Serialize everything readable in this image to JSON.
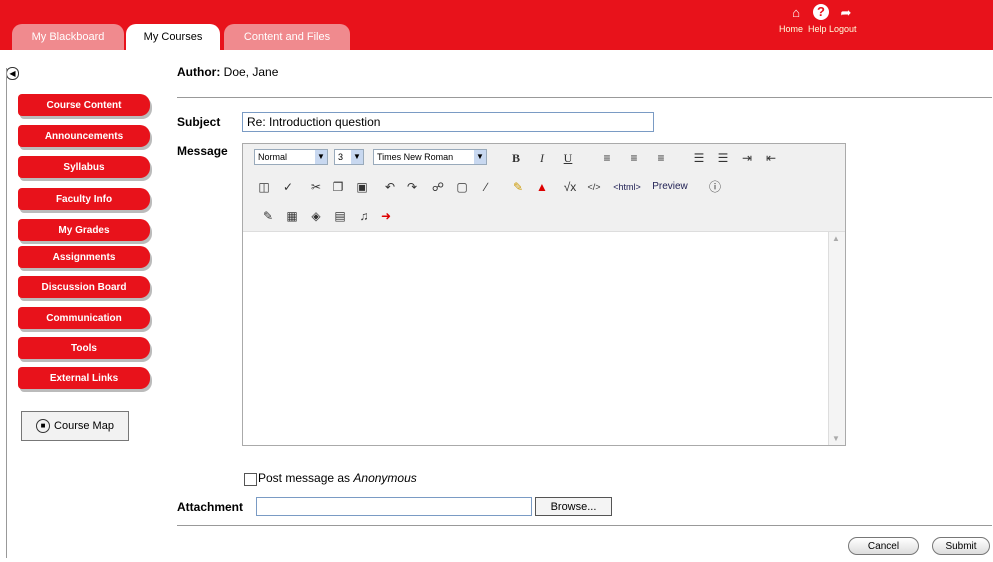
{
  "tabs": [
    {
      "label": "My Blackboard",
      "active": false
    },
    {
      "label": "My Courses",
      "active": true
    },
    {
      "label": "Content and Files",
      "active": false
    }
  ],
  "topnav": {
    "home": "Home",
    "help": "Help",
    "logout": "Logout"
  },
  "sidebar": {
    "items": [
      {
        "label": "Course Content"
      },
      {
        "label": "Announcements"
      },
      {
        "label": "Syllabus"
      },
      {
        "label": "Faculty Info"
      },
      {
        "label": "My Grades"
      },
      {
        "label": "Assignments"
      },
      {
        "label": "Discussion Board"
      },
      {
        "label": "Communication"
      },
      {
        "label": "Tools"
      },
      {
        "label": "External Links"
      }
    ],
    "course_map": "Course Map"
  },
  "author": {
    "label": "Author:",
    "value": "Doe, Jane"
  },
  "subject": {
    "label": "Subject",
    "value": "Re: Introduction question"
  },
  "message": {
    "label": "Message"
  },
  "editor": {
    "format": "Normal",
    "size": "3",
    "font": "Times New Roman",
    "html_label": "<html>",
    "preview": "Preview"
  },
  "anonymous": {
    "label_prefix": "Post message as ",
    "label_em": "Anonymous",
    "checked": false
  },
  "attachment": {
    "label": "Attachment",
    "value": "",
    "browse": "Browse..."
  },
  "actions": {
    "cancel": "Cancel",
    "submit": "Submit"
  },
  "colors": {
    "brand": "#e8121b"
  }
}
